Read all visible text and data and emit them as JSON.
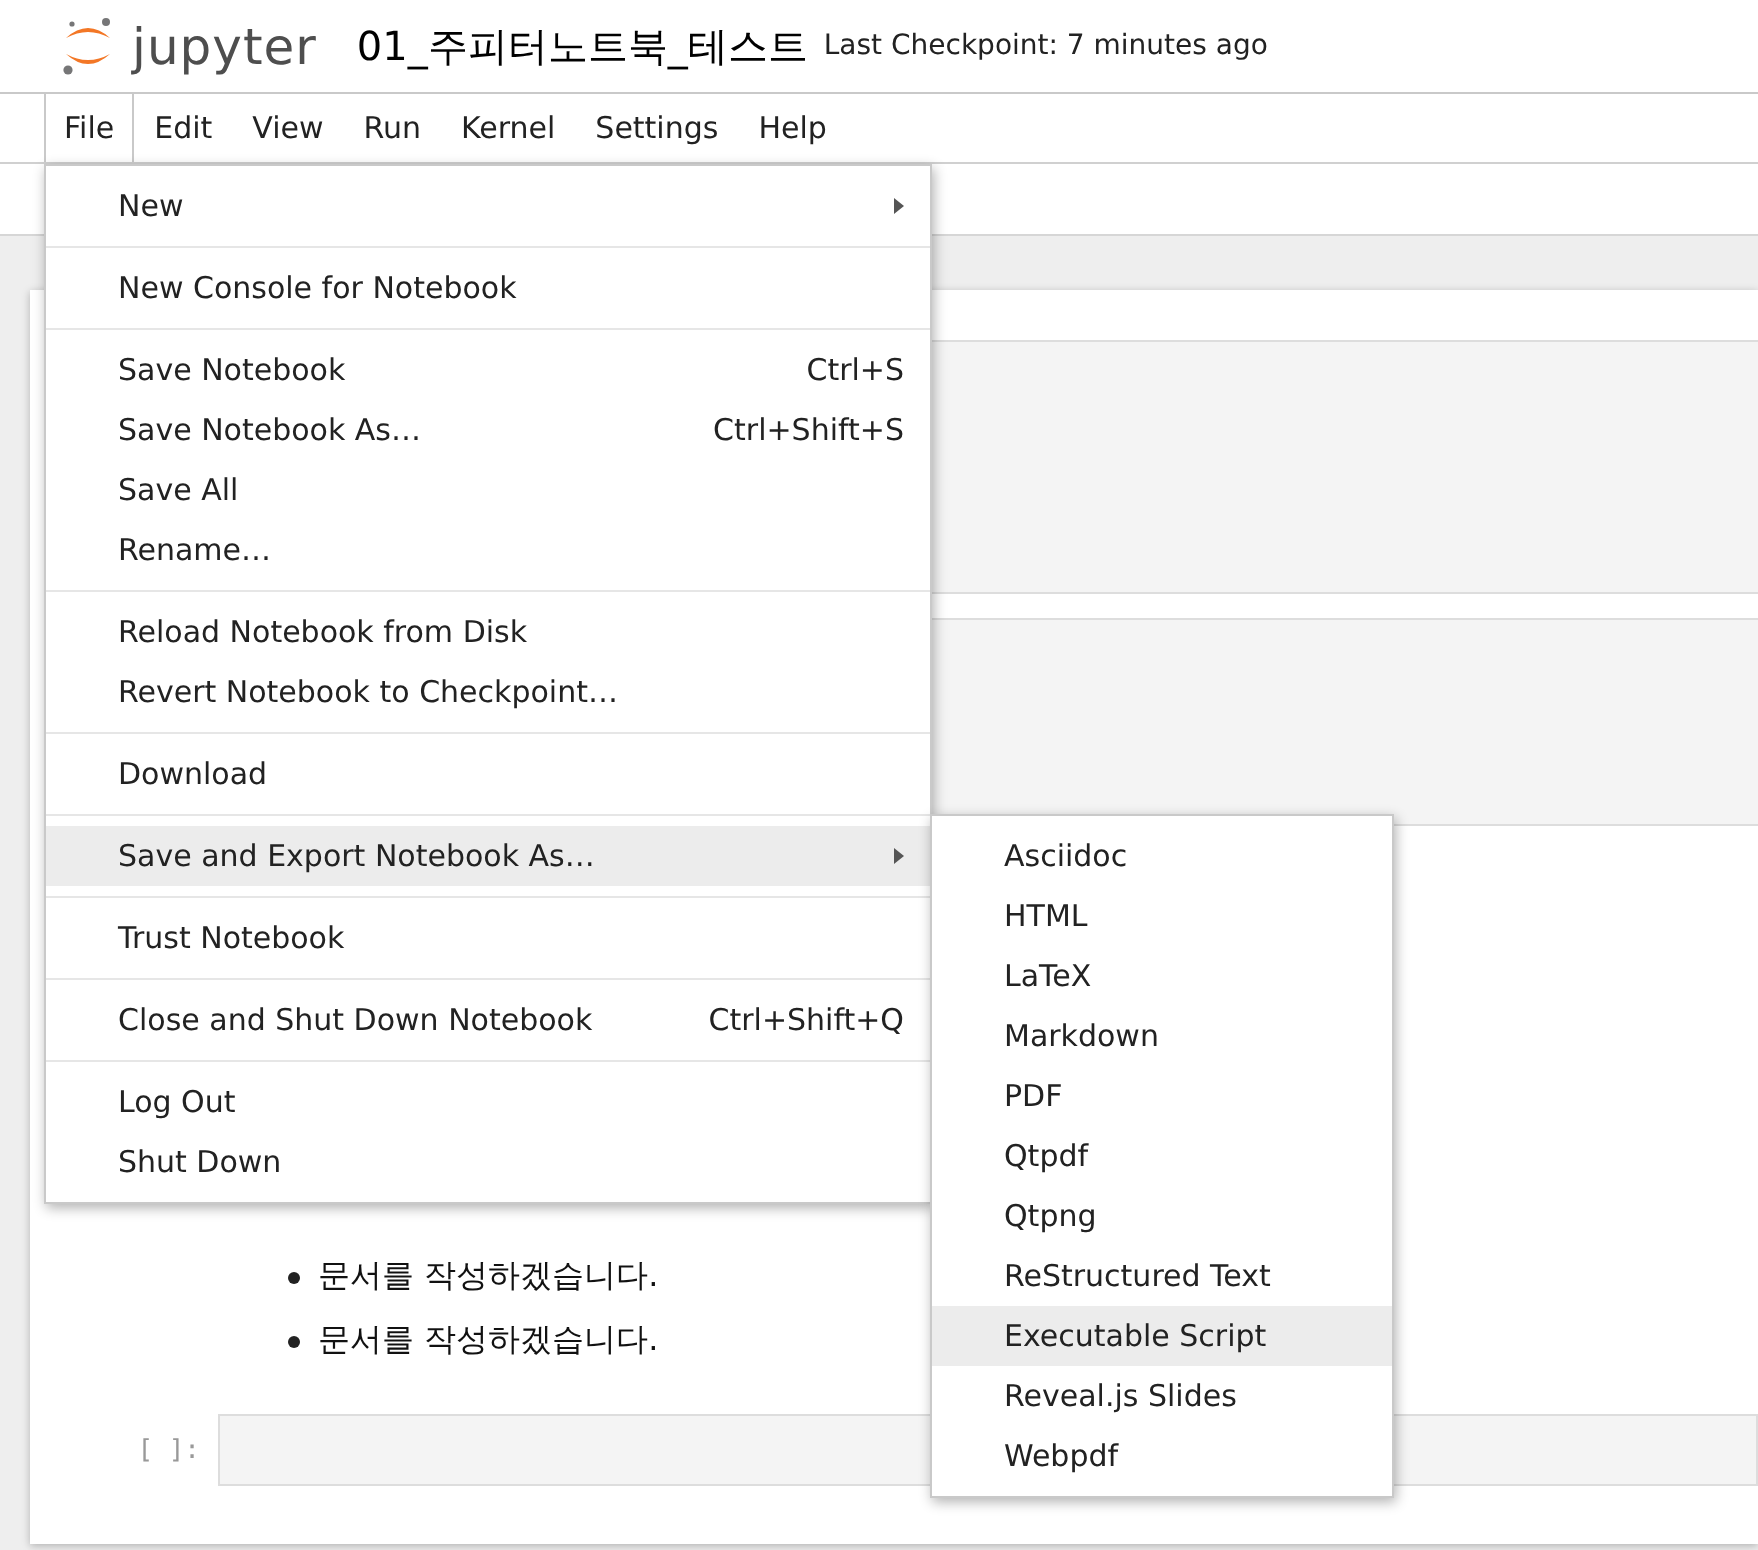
{
  "header": {
    "logo_text": "jupyter",
    "title": "01_주피터노트북_테스트",
    "checkpoint": "Last Checkpoint: 7 minutes ago"
  },
  "menubar": [
    {
      "label": "File",
      "selected": true
    },
    {
      "label": "Edit",
      "selected": false
    },
    {
      "label": "View",
      "selected": false
    },
    {
      "label": "Run",
      "selected": false
    },
    {
      "label": "Kernel",
      "selected": false
    },
    {
      "label": "Settings",
      "selected": false
    },
    {
      "label": "Help",
      "selected": false
    }
  ],
  "notebook": {
    "bullets": [
      "문서를 작성하겠습니다.",
      "문서를 작성하겠습니다."
    ],
    "prompt": "[ ]:"
  },
  "file_menu": [
    [
      {
        "label": "New",
        "has_submenu": true,
        "selected": false
      }
    ],
    [
      {
        "label": "New Console for Notebook",
        "has_submenu": false,
        "selected": false
      }
    ],
    [
      {
        "label": "Save Notebook",
        "shortcut": "Ctrl+S",
        "has_submenu": false,
        "selected": false
      },
      {
        "label": "Save Notebook As…",
        "shortcut": "Ctrl+Shift+S",
        "has_submenu": false,
        "selected": false
      },
      {
        "label": "Save All",
        "has_submenu": false,
        "selected": false
      },
      {
        "label": "Rename…",
        "has_submenu": false,
        "selected": false
      }
    ],
    [
      {
        "label": "Reload Notebook from Disk",
        "has_submenu": false,
        "selected": false
      },
      {
        "label": "Revert Notebook to Checkpoint…",
        "has_submenu": false,
        "selected": false
      }
    ],
    [
      {
        "label": "Download",
        "has_submenu": false,
        "selected": false
      }
    ],
    [
      {
        "label": "Save and Export Notebook As…",
        "has_submenu": true,
        "selected": true
      }
    ],
    [
      {
        "label": "Trust Notebook",
        "has_submenu": false,
        "selected": false
      }
    ],
    [
      {
        "label": "Close and Shut Down Notebook",
        "shortcut": "Ctrl+Shift+Q",
        "has_submenu": false,
        "selected": false
      }
    ],
    [
      {
        "label": "Log Out",
        "has_submenu": false,
        "selected": false
      },
      {
        "label": "Shut Down",
        "has_submenu": false,
        "selected": false
      }
    ]
  ],
  "export_submenu": [
    {
      "label": "Asciidoc",
      "selected": false
    },
    {
      "label": "HTML",
      "selected": false
    },
    {
      "label": "LaTeX",
      "selected": false
    },
    {
      "label": "Markdown",
      "selected": false
    },
    {
      "label": "PDF",
      "selected": false
    },
    {
      "label": "Qtpdf",
      "selected": false
    },
    {
      "label": "Qtpng",
      "selected": false
    },
    {
      "label": "ReStructured Text",
      "selected": false
    },
    {
      "label": "Executable Script",
      "selected": true
    },
    {
      "label": "Reveal.js Slides",
      "selected": false
    },
    {
      "label": "Webpdf",
      "selected": false
    }
  ]
}
